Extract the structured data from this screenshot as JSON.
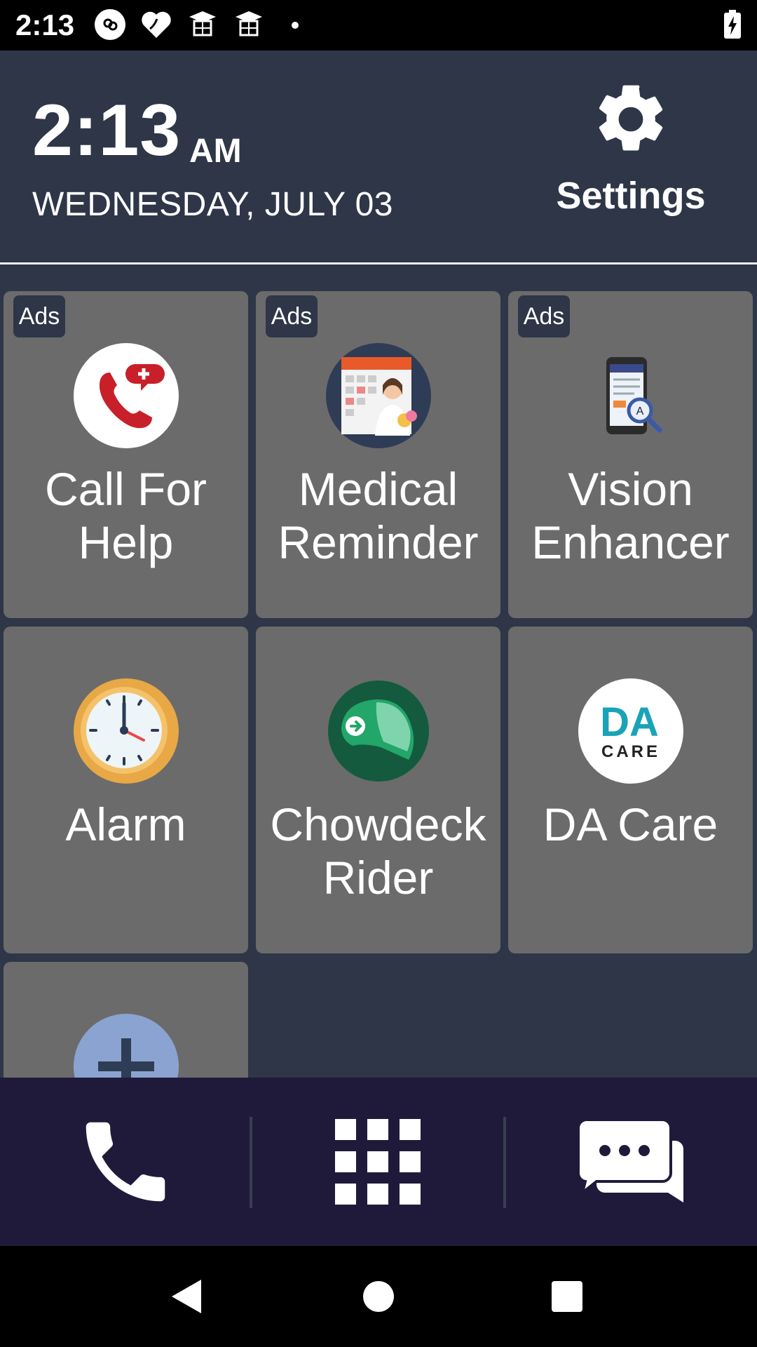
{
  "status_bar": {
    "time": "2:13",
    "icons": [
      "bubble-app-icon",
      "heart-app-icon",
      "graduation-cap-icon",
      "graduation-cap-icon",
      "dot-icon"
    ],
    "battery": "battery-charging-icon"
  },
  "header": {
    "time": "2:13",
    "ampm": "AM",
    "date": "WEDNESDAY, JULY 03",
    "settings_label": "Settings"
  },
  "tiles": [
    {
      "label": "Call For Help",
      "ads": "Ads",
      "icon": "call-for-help-icon"
    },
    {
      "label": "Medical Reminder",
      "ads": "Ads",
      "icon": "medical-reminder-icon"
    },
    {
      "label": "Vision Enhancer",
      "ads": "Ads",
      "icon": "vision-enhancer-icon"
    },
    {
      "label": "Alarm",
      "icon": "alarm-clock-icon"
    },
    {
      "label": "Chowdeck Rider",
      "icon": "chowdeck-helmet-icon"
    },
    {
      "label": "DA Care",
      "icon": "da-care-icon",
      "logo_text": "DA",
      "logo_subtext": "CARE"
    },
    {
      "label": "",
      "icon": "add-icon"
    }
  ],
  "bottom_bar": [
    "phone-icon",
    "app-grid-icon",
    "messages-icon"
  ],
  "nav_bar": [
    "back-icon",
    "home-icon",
    "recents-icon"
  ],
  "colors": {
    "background": "#2e3648",
    "tile": "#6b6b6b",
    "bottom_bar": "#201a3a",
    "accent_red": "#c8202a",
    "da_teal": "#1aa3b8"
  }
}
